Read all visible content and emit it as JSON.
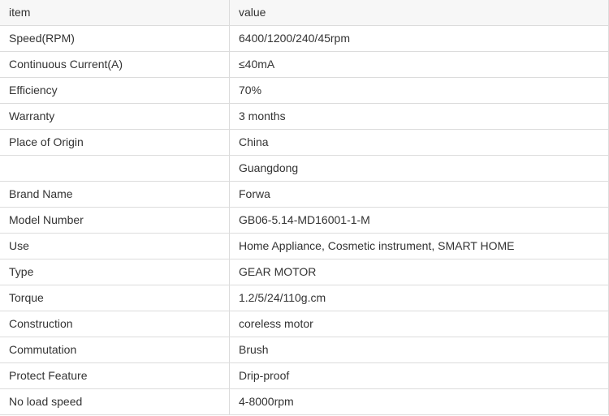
{
  "table": {
    "header": {
      "key": "item",
      "value": "value"
    },
    "rows": [
      {
        "key": "Speed(RPM)",
        "value": "6400/1200/240/45rpm"
      },
      {
        "key": "Continuous Current(A)",
        "value": "≤40mA"
      },
      {
        "key": "Efficiency",
        "value": "70%"
      },
      {
        "key": "Warranty",
        "value": "3 months"
      },
      {
        "key": "Place of Origin",
        "value": "China"
      },
      {
        "key": "",
        "value": "Guangdong"
      },
      {
        "key": "Brand Name",
        "value": "Forwa"
      },
      {
        "key": "Model Number",
        "value": "GB06-5.14-MD16001-1-M"
      },
      {
        "key": "Use",
        "value": "Home Appliance, Cosmetic instrument, SMART HOME"
      },
      {
        "key": "Type",
        "value": "GEAR MOTOR"
      },
      {
        "key": "Torque",
        "value": "1.2/5/24/110g.cm"
      },
      {
        "key": "Construction",
        "value": "coreless motor"
      },
      {
        "key": "Commutation",
        "value": "Brush"
      },
      {
        "key": "Protect Feature",
        "value": "Drip-proof"
      },
      {
        "key": "No load speed",
        "value": "4-8000rpm"
      }
    ]
  }
}
